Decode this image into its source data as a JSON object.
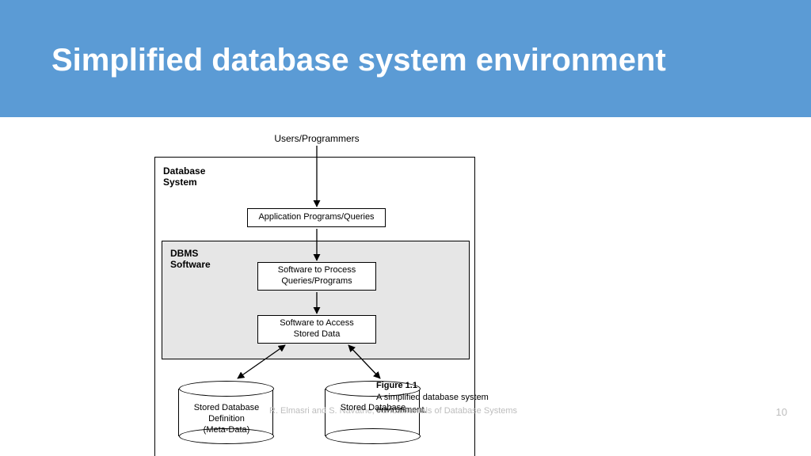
{
  "header": {
    "title": "Simplified database system environment"
  },
  "diagram": {
    "topLabel": "Users/Programmers",
    "outerBoxLabel": "Database\nSystem",
    "dbmsLabel": "DBMS\nSoftware",
    "nodes": {
      "app": "Application Programs/Queries",
      "processQueries": "Software to Process\nQueries/Programs",
      "accessData": "Software to Access\nStored Data"
    },
    "cylinders": {
      "left": "Stored Database\nDefinition\n(Meta-Data)",
      "right": "Stored Database"
    }
  },
  "figure": {
    "number": "Figure 1.1",
    "caption": "A simplified database system environment."
  },
  "footer": {
    "citation": "R. Elmasri and S. Navathe, Fundamentals of Database Systems",
    "pageNumber": "10"
  }
}
